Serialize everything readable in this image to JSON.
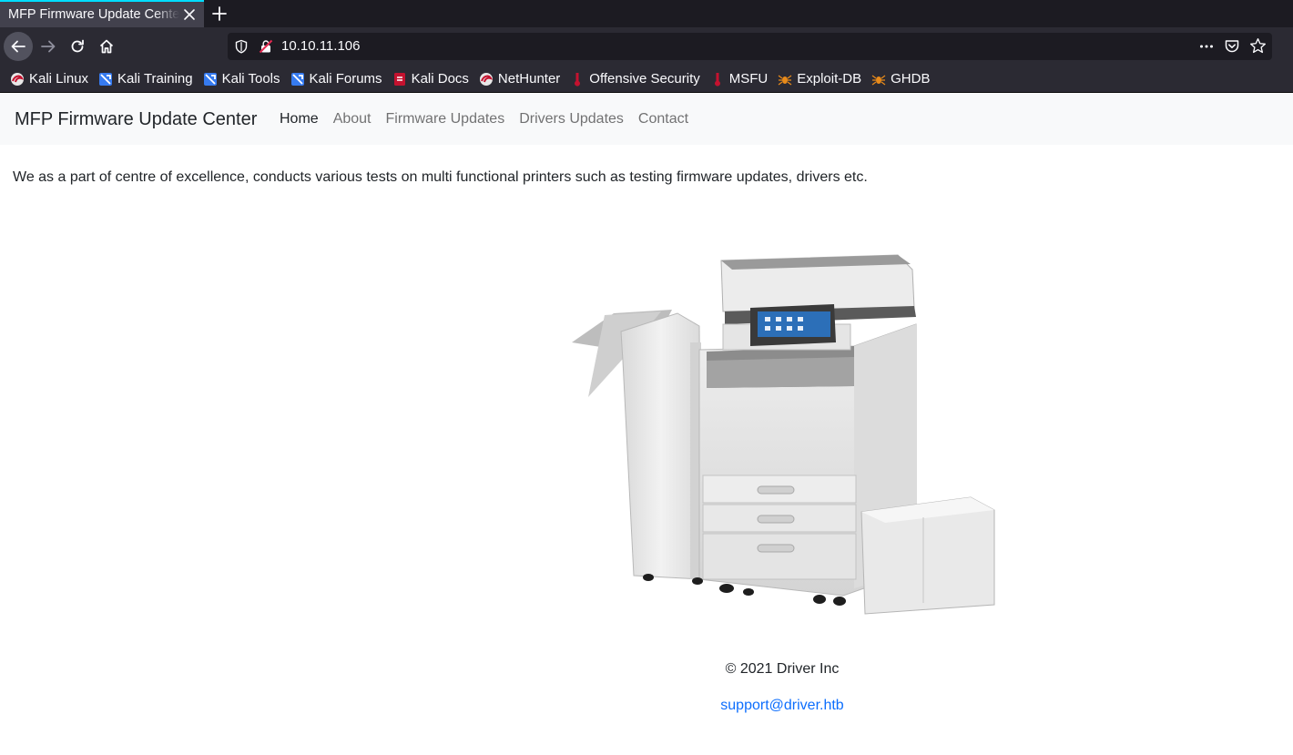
{
  "browser": {
    "tab_title": "MFP Firmware Update Center",
    "url": "10.10.11.106",
    "bookmarks": [
      {
        "label": "Kali Linux",
        "icon": "kali-dragon-icon"
      },
      {
        "label": "Kali Training",
        "icon": "kali-training-icon"
      },
      {
        "label": "Kali Tools",
        "icon": "kali-tools-icon"
      },
      {
        "label": "Kali Forums",
        "icon": "kali-forums-icon"
      },
      {
        "label": "Kali Docs",
        "icon": "kali-docs-icon"
      },
      {
        "label": "NetHunter",
        "icon": "nethunter-icon"
      },
      {
        "label": "Offensive Security",
        "icon": "offsec-icon"
      },
      {
        "label": "MSFU",
        "icon": "msfu-icon"
      },
      {
        "label": "Exploit-DB",
        "icon": "exploit-db-icon"
      },
      {
        "label": "GHDB",
        "icon": "ghdb-icon"
      }
    ],
    "accent": "#00ddff"
  },
  "site": {
    "brand": "MFP Firmware Update Center",
    "nav": [
      {
        "label": "Home",
        "active": true
      },
      {
        "label": "About",
        "active": false
      },
      {
        "label": "Firmware Updates",
        "active": false
      },
      {
        "label": "Drivers Updates",
        "active": false
      },
      {
        "label": "Contact",
        "active": false
      }
    ],
    "intro": "We as a part of centre of excellence, conducts various tests on multi functional printers such as testing firmware updates, drivers etc.",
    "copyright": "© 2021 Driver Inc",
    "email": "support@driver.htb",
    "link_color": "#0d6efd"
  }
}
